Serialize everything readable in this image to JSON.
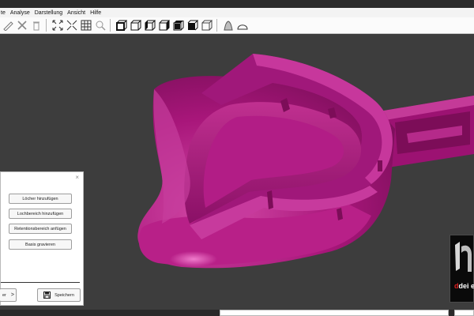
{
  "menu": {
    "items": [
      "te",
      "Analyse",
      "Darstellung",
      "Ansicht",
      "Hilfe"
    ]
  },
  "toolbar": {
    "icons": [
      "measure-icon",
      "cut-icon",
      "delete-icon",
      "expand-icon",
      "collapse-icon",
      "grid-icon",
      "magnifier-icon",
      "view-cube-front-icon",
      "view-cube-back-icon",
      "view-cube-left-icon",
      "view-cube-right-icon",
      "view-cube-top-icon",
      "view-cube-bottom-icon",
      "view-cube-iso-icon",
      "bell-shape-icon",
      "dome-shape-icon"
    ]
  },
  "panel": {
    "close": "×",
    "buttons": [
      "Löcher hinzufügen",
      "Lochbereich hinzufügen",
      "Retentionsbereich anfügen",
      "Basis gravieren"
    ],
    "next_label": "er",
    "next_arrow": ">",
    "save_label": "Speichern"
  },
  "logo": {
    "text": "dei e"
  },
  "colors": {
    "model": "#b0197e",
    "model_dark": "#7a0d57",
    "model_light": "#d95bb3",
    "background": "#3d3d3d"
  }
}
